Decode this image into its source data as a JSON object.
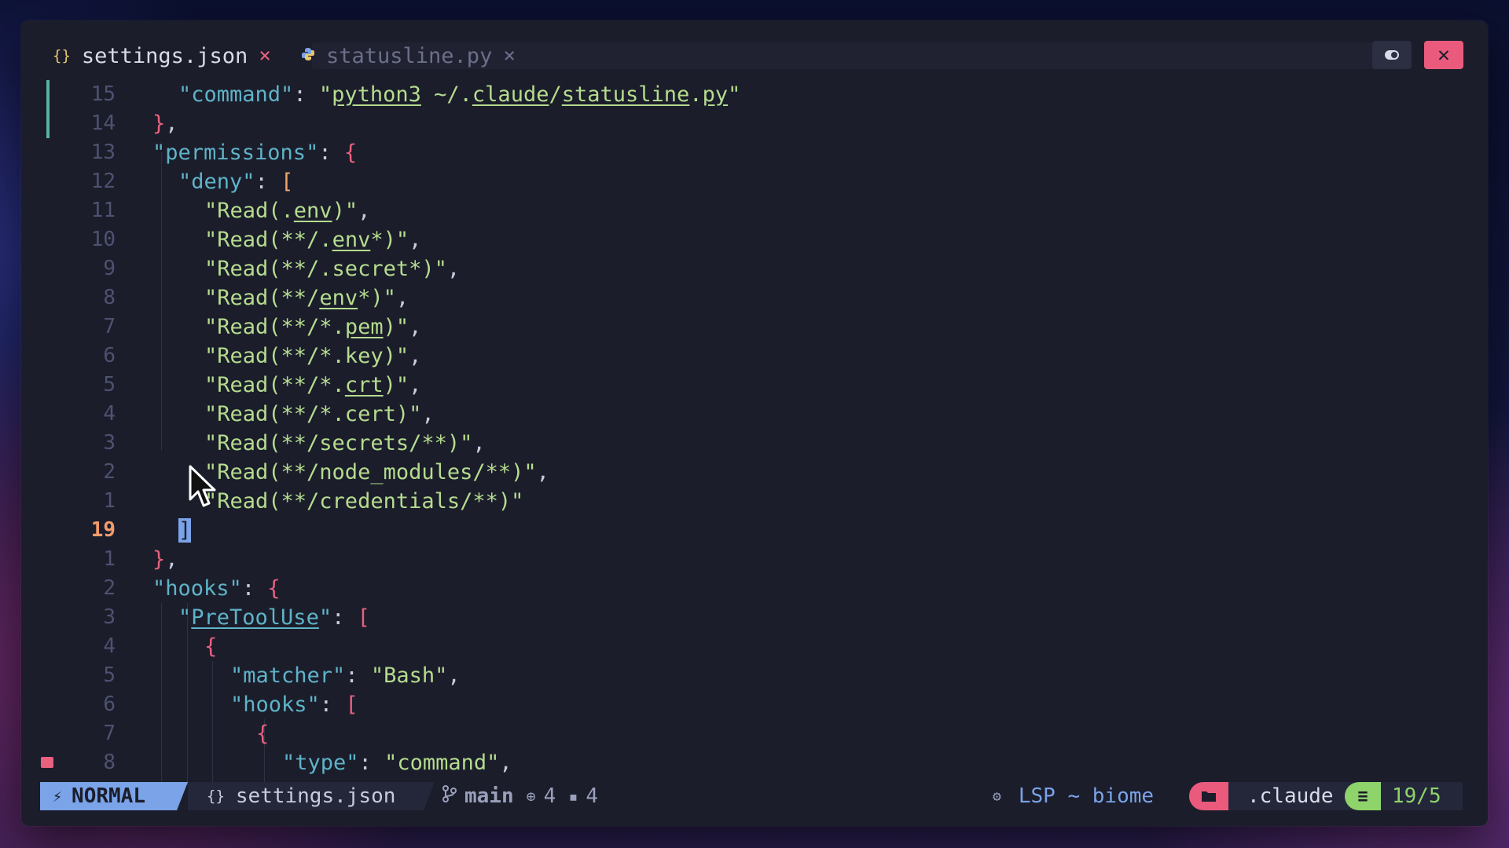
{
  "tabs": [
    {
      "icon": "{}",
      "label": "settings.json",
      "close": "×",
      "active": true
    },
    {
      "icon": "py",
      "label": "statusline.py",
      "close": "×",
      "active": false
    }
  ],
  "window_buttons": {
    "toggle": "⬬",
    "close": "✕"
  },
  "editor": {
    "lines": [
      {
        "num": "15",
        "indent": 1
      },
      {
        "num": "14",
        "indent": 0
      },
      {
        "num": "13",
        "indent": 0
      },
      {
        "num": "12",
        "indent": 1
      },
      {
        "num": "11",
        "indent": 2
      },
      {
        "num": "10",
        "indent": 2
      },
      {
        "num": "9",
        "indent": 2
      },
      {
        "num": "8",
        "indent": 2
      },
      {
        "num": "7",
        "indent": 2
      },
      {
        "num": "6",
        "indent": 2
      },
      {
        "num": "5",
        "indent": 2
      },
      {
        "num": "4",
        "indent": 2
      },
      {
        "num": "3",
        "indent": 2
      },
      {
        "num": "2",
        "indent": 2
      },
      {
        "num": "1",
        "indent": 2
      },
      {
        "num": "19",
        "indent": 1,
        "current": true
      },
      {
        "num": "1",
        "indent": 0
      },
      {
        "num": "2",
        "indent": 0
      },
      {
        "num": "3",
        "indent": 1
      },
      {
        "num": "4",
        "indent": 2
      },
      {
        "num": "5",
        "indent": 3
      },
      {
        "num": "6",
        "indent": 3
      },
      {
        "num": "7",
        "indent": 4
      },
      {
        "num": "8",
        "indent": 5
      }
    ],
    "text": {
      "l0": [
        "\"command\"",
        ": ",
        "\"",
        "python3",
        " ~/.",
        "claude",
        "/",
        "statusline",
        ".",
        "py",
        "\""
      ],
      "l1": [
        "}",
        ","
      ],
      "l2": [
        "\"permissions\"",
        ": ",
        "{"
      ],
      "l3": [
        "\"deny\"",
        ": ",
        "["
      ],
      "l4": [
        "\"Read(.",
        "env",
        ")\"",
        ","
      ],
      "l5": [
        "\"Read(**/.",
        "env",
        "*)\"",
        ","
      ],
      "l6": [
        "\"Read(**/.secret*)\"",
        ","
      ],
      "l7": [
        "\"Read(**/",
        "env",
        "*)\"",
        ","
      ],
      "l8": [
        "\"Read(**/*.",
        "pem",
        ")\"",
        ","
      ],
      "l9": [
        "\"Read(**/*.key)\"",
        ","
      ],
      "l10": [
        "\"Read(**/*.",
        "crt",
        ")\"",
        ","
      ],
      "l11": [
        "\"Read(**/*.cert)\"",
        ","
      ],
      "l12": [
        "\"Read(**/secrets/**)\"",
        ","
      ],
      "l13": [
        "\"Read(**/node_modules/**)\"",
        ","
      ],
      "l14": [
        "\"Read(**/credentials/**)\""
      ],
      "l15": [
        "]"
      ],
      "l16": [
        "}",
        ","
      ],
      "l17": [
        "\"hoo",
        "k",
        "s\"",
        ": ",
        "{"
      ],
      "l18": [
        "\"",
        "PreToolUse",
        "\"",
        ": ",
        "["
      ],
      "l19": [
        "{"
      ],
      "l20": [
        "\"matcher\"",
        ": ",
        "\"Bash\"",
        ","
      ],
      "l21": [
        "\"hooks\"",
        ": ",
        "["
      ],
      "l22": [
        "{"
      ],
      "l23": [
        "\"type\"",
        ": ",
        "\"command\"",
        ","
      ]
    }
  },
  "statusline": {
    "mode": "NORMAL",
    "file_icon": "{}",
    "file": "settings.json",
    "branch": "main",
    "add_count": "4",
    "mod_count": "4",
    "lsp": "LSP ~ biome",
    "dir": ".claude",
    "position": "19/5"
  },
  "colors": {
    "key": "#5fb3c8",
    "string": "#b5dc8e",
    "brace": "#e8617e",
    "bracket": "#f3a56b",
    "mode_bg": "#7aa3e8",
    "close_bg": "#ea5a7c",
    "pos_accent": "#8fd36b"
  }
}
